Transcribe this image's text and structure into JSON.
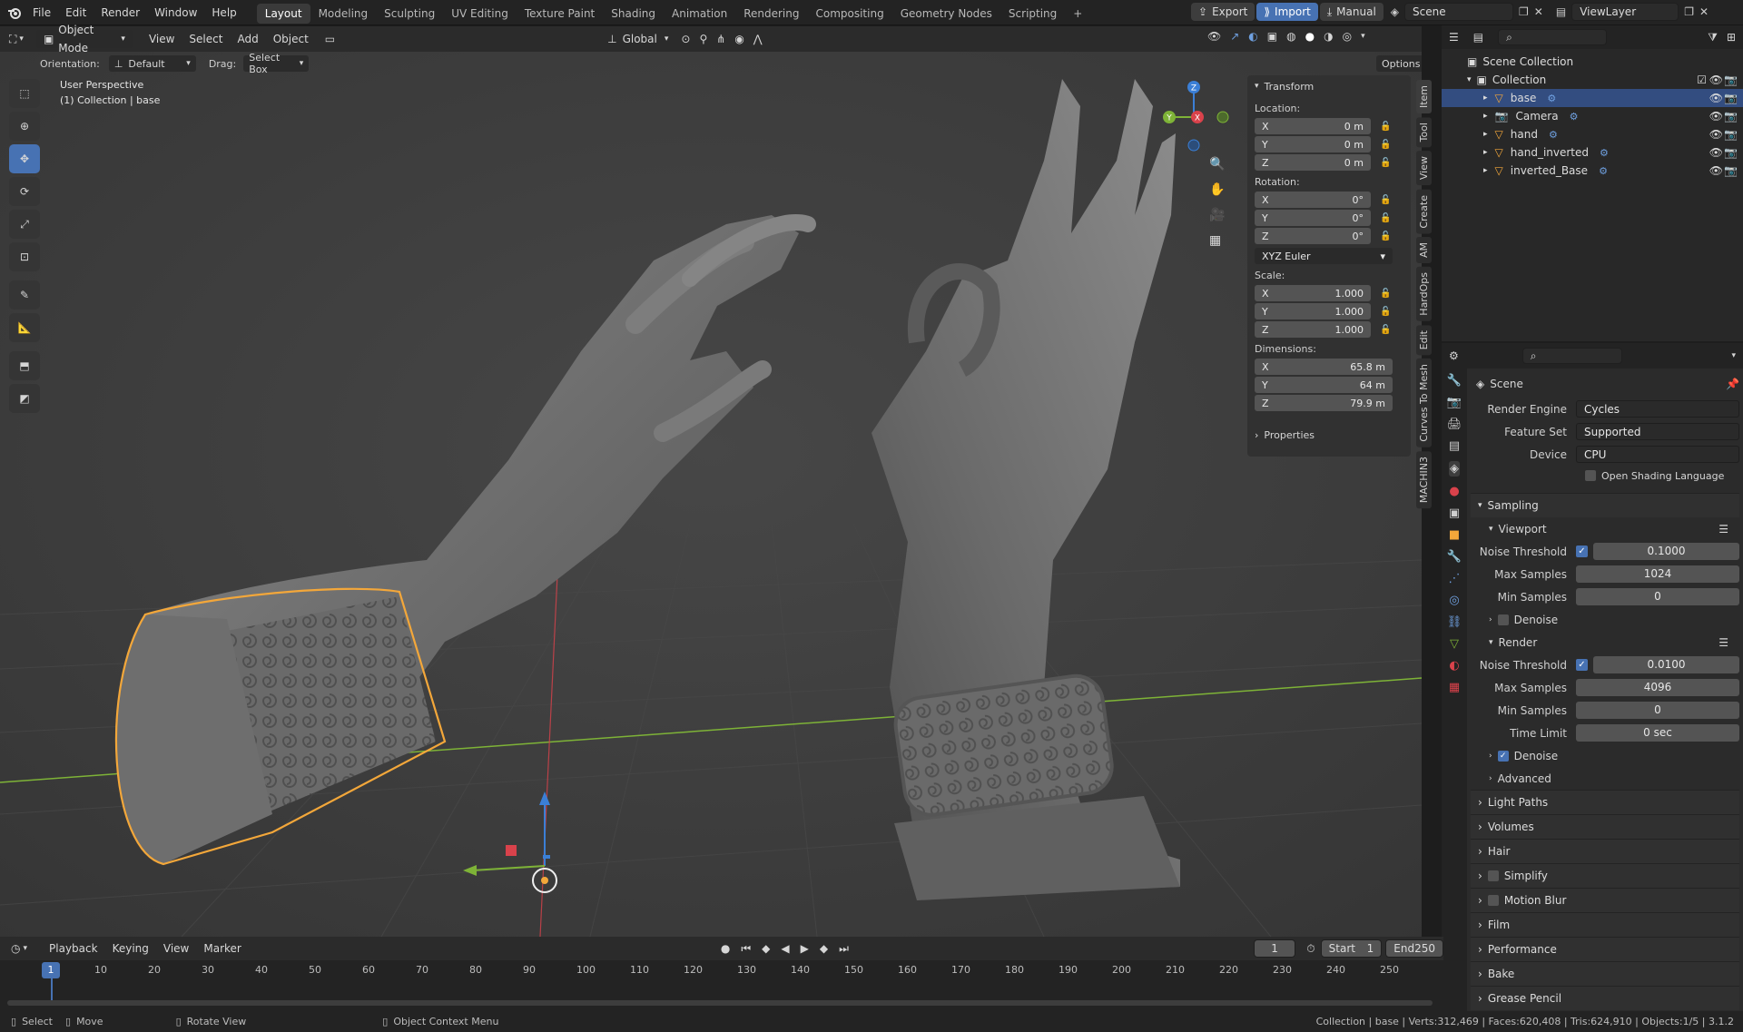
{
  "topbar": {
    "menus": [
      "File",
      "Edit",
      "Render",
      "Window",
      "Help"
    ],
    "workspaces": [
      "Layout",
      "Modeling",
      "Sculpting",
      "UV Editing",
      "Texture Paint",
      "Shading",
      "Animation",
      "Rendering",
      "Compositing",
      "Geometry Nodes",
      "Scripting"
    ],
    "active_workspace": "Layout",
    "add_tab": "+",
    "export_label": "Export",
    "import_label": "Import",
    "manual_label": "Manual",
    "scene_name": "Scene",
    "view_layer": "ViewLayer"
  },
  "viewport_header": {
    "mode": "Object Mode",
    "menus": [
      "View",
      "Select",
      "Add",
      "Object"
    ],
    "transform_orientation": "Global",
    "orientation_label": "Orientation:",
    "orientation_value": "Default",
    "drag_label": "Drag:",
    "drag_value": "Select Box",
    "options_label": "Options"
  },
  "viewport": {
    "view_name": "User Perspective",
    "collection_info": "(1) Collection | base",
    "gizmo_axes": [
      "Z",
      "Y",
      "X"
    ]
  },
  "npanel": {
    "transform_title": "Transform",
    "location_label": "Location:",
    "location": [
      {
        "axis": "X",
        "value": "0 m"
      },
      {
        "axis": "Y",
        "value": "0 m"
      },
      {
        "axis": "Z",
        "value": "0 m"
      }
    ],
    "rotation_label": "Rotation:",
    "rotation": [
      {
        "axis": "X",
        "value": "0°"
      },
      {
        "axis": "Y",
        "value": "0°"
      },
      {
        "axis": "Z",
        "value": "0°"
      }
    ],
    "rotation_mode": "XYZ Euler",
    "scale_label": "Scale:",
    "scale": [
      {
        "axis": "X",
        "value": "1.000"
      },
      {
        "axis": "Y",
        "value": "1.000"
      },
      {
        "axis": "Z",
        "value": "1.000"
      }
    ],
    "dimensions_label": "Dimensions:",
    "dimensions": [
      {
        "axis": "X",
        "value": "65.8 m"
      },
      {
        "axis": "Y",
        "value": "64 m"
      },
      {
        "axis": "Z",
        "value": "79.9 m"
      }
    ],
    "properties_title": "Properties",
    "side_tabs": [
      "Item",
      "Tool",
      "View",
      "Create",
      "AM",
      "HardOps",
      "Edit",
      "Curves To Mesh",
      "MACHIN3"
    ]
  },
  "outliner": {
    "root": "Scene Collection",
    "collection": "Collection",
    "items": [
      {
        "name": "base",
        "selected": true
      },
      {
        "name": "Camera",
        "selected": false
      },
      {
        "name": "hand",
        "selected": false
      },
      {
        "name": "hand_inverted",
        "selected": false
      },
      {
        "name": "inverted_Base",
        "selected": false
      }
    ]
  },
  "properties": {
    "context": "Scene",
    "render_engine_label": "Render Engine",
    "render_engine": "Cycles",
    "feature_set_label": "Feature Set",
    "feature_set": "Supported",
    "device_label": "Device",
    "device": "CPU",
    "osl_label": "Open Shading Language",
    "sampling_title": "Sampling",
    "viewport_title": "Viewport",
    "viewport_noise_label": "Noise Threshold",
    "viewport_noise": "0.1000",
    "viewport_max_label": "Max Samples",
    "viewport_max": "1024",
    "viewport_min_label": "Min Samples",
    "viewport_min": "0",
    "denoise_label": "Denoise",
    "render_title": "Render",
    "render_noise_label": "Noise Threshold",
    "render_noise": "0.0100",
    "render_max_label": "Max Samples",
    "render_max": "4096",
    "render_min_label": "Min Samples",
    "render_min": "0",
    "time_limit_label": "Time Limit",
    "time_limit": "0 sec",
    "render_denoise_label": "Denoise",
    "advanced_label": "Advanced",
    "panels": [
      "Light Paths",
      "Volumes",
      "Hair",
      "Simplify",
      "Motion Blur",
      "Film",
      "Performance",
      "Bake",
      "Grease Pencil"
    ]
  },
  "timeline": {
    "menus": [
      "Playback",
      "Keying",
      "View",
      "Marker"
    ],
    "current_frame": "1",
    "start_label": "Start",
    "start": "1",
    "end_label": "End",
    "end": "250",
    "ruler": [
      "10",
      "20",
      "30",
      "40",
      "50",
      "60",
      "70",
      "80",
      "90",
      "100",
      "110",
      "120",
      "130",
      "140",
      "150",
      "160",
      "170",
      "180",
      "190",
      "200",
      "210",
      "220",
      "230",
      "240",
      "250"
    ],
    "playhead": "1"
  },
  "statusbar": {
    "select": "Select",
    "move": "Move",
    "rotate": "Rotate View",
    "context_menu": "Object Context Menu",
    "stats": "Collection | base | Verts:312,469 | Faces:620,408 | Tris:624,910 | Objects:1/5 | 3.1.2"
  },
  "colors": {
    "accent": "#4772b3",
    "selection_outline": "#f3a73a",
    "x_axis": "#d9424b",
    "y_axis": "#7eb337",
    "z_axis": "#3b7fd6"
  }
}
